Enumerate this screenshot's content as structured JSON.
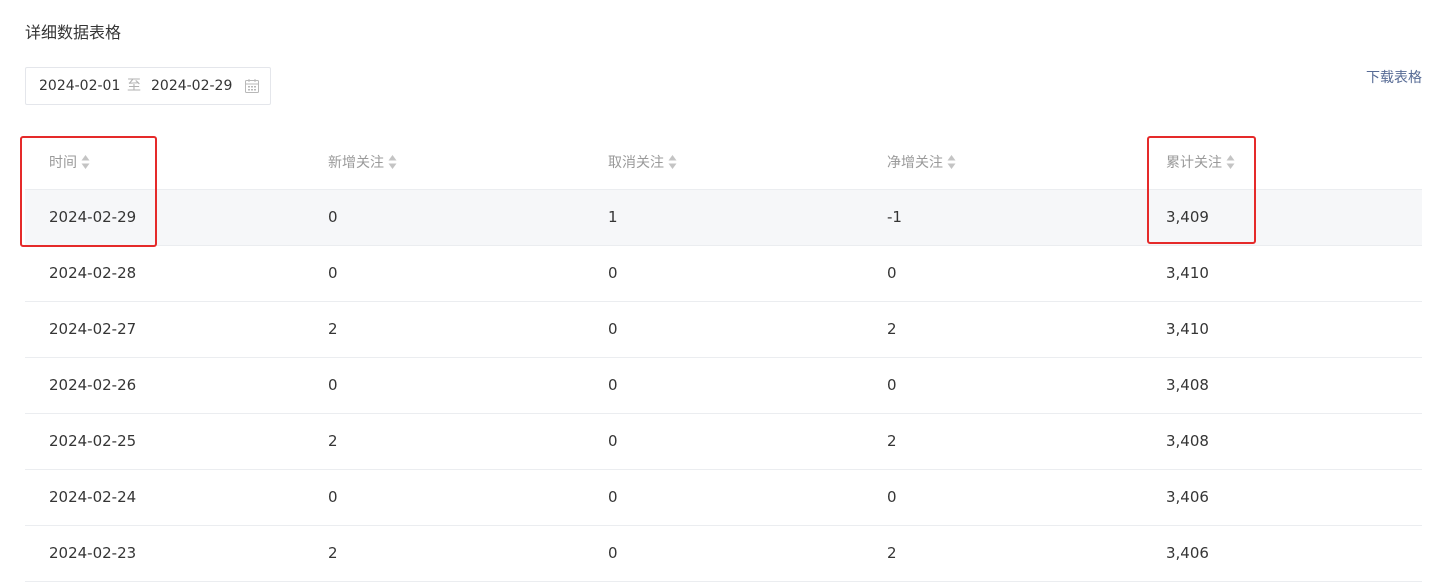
{
  "section_title": "详细数据表格",
  "date_range": {
    "start": "2024-02-01",
    "separator": "至",
    "end": "2024-02-29",
    "icon": "calendar-icon"
  },
  "download_label": "下载表格",
  "table": {
    "headers": [
      "时间",
      "新增关注",
      "取消关注",
      "净增关注",
      "累计关注"
    ],
    "rows": [
      [
        "2024-02-29",
        "0",
        "1",
        "-1",
        "3,409"
      ],
      [
        "2024-02-28",
        "0",
        "0",
        "0",
        "3,410"
      ],
      [
        "2024-02-27",
        "2",
        "0",
        "2",
        "3,410"
      ],
      [
        "2024-02-26",
        "0",
        "0",
        "0",
        "3,408"
      ],
      [
        "2024-02-25",
        "2",
        "0",
        "2",
        "3,408"
      ],
      [
        "2024-02-24",
        "0",
        "0",
        "0",
        "3,406"
      ],
      [
        "2024-02-23",
        "2",
        "0",
        "2",
        "3,406"
      ]
    ]
  },
  "colors": {
    "annotation": "#e52a2a",
    "link": "#576b95",
    "header_text": "#9a9a9a",
    "row_highlight": "#f6f7f9"
  }
}
